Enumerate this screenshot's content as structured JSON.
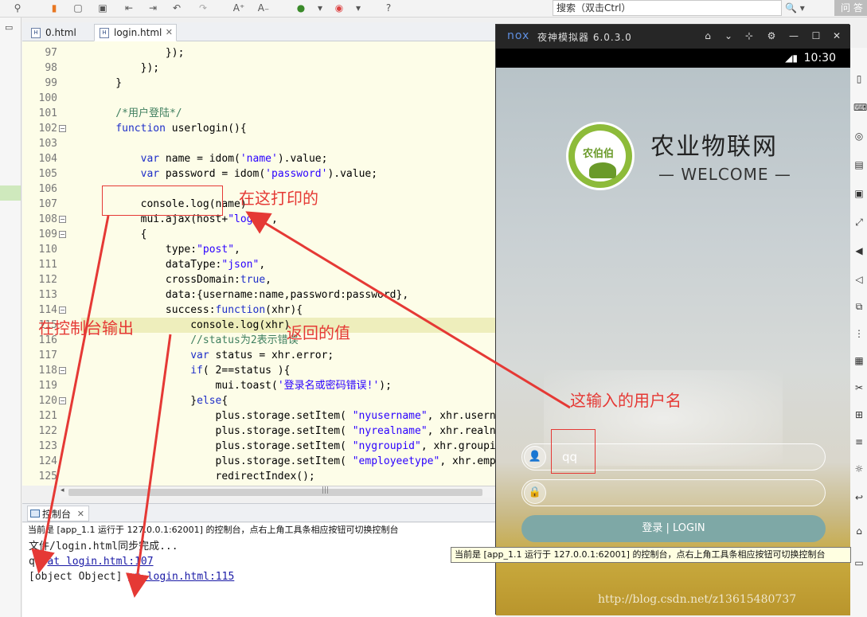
{
  "toolbar": {
    "search_placeholder": "搜索（双击Ctrl）",
    "search_button": "🔍 ▾",
    "ask_button": "问 答"
  },
  "editor": {
    "tabs": [
      {
        "label": "0.html"
      },
      {
        "label": "login.html",
        "close": "✕"
      }
    ],
    "lines": [
      {
        "num": "97",
        "text": "            });"
      },
      {
        "num": "98",
        "text": "        });"
      },
      {
        "num": "99",
        "text": "    }"
      },
      {
        "num": "100",
        "text": ""
      },
      {
        "num": "101",
        "text": "    /*用户登陆*/"
      },
      {
        "num": "102",
        "text": "    function userlogin(){"
      },
      {
        "num": "103",
        "text": ""
      },
      {
        "num": "104",
        "text": "        var name = idom('name').value;"
      },
      {
        "num": "105",
        "text": "        var password = idom('password').value;"
      },
      {
        "num": "106",
        "text": ""
      },
      {
        "num": "107",
        "text": "        console.log(name)"
      },
      {
        "num": "108",
        "text": "        mui.ajax(host+\"login\","
      },
      {
        "num": "109",
        "text": "        {"
      },
      {
        "num": "110",
        "text": "            type:\"post\","
      },
      {
        "num": "111",
        "text": "            dataType:\"json\","
      },
      {
        "num": "112",
        "text": "            crossDomain:true,"
      },
      {
        "num": "113",
        "text": "            data:{username:name,password:password},"
      },
      {
        "num": "114",
        "text": "            success:function(xhr){"
      },
      {
        "num": "115",
        "text": "                console.log(xhr)"
      },
      {
        "num": "116",
        "text": "                //status为2表示错误"
      },
      {
        "num": "117",
        "text": "                var status = xhr.error;"
      },
      {
        "num": "118",
        "text": "                if( 2==status ){"
      },
      {
        "num": "119",
        "text": "                    mui.toast('登录名或密码错误!');"
      },
      {
        "num": "120",
        "text": "                }else{"
      },
      {
        "num": "121",
        "text": "                    plus.storage.setItem( \"nyusername\", xhr.username"
      },
      {
        "num": "122",
        "text": "                    plus.storage.setItem( \"nyrealname\", xhr.realname"
      },
      {
        "num": "123",
        "text": "                    plus.storage.setItem( \"nygroupid\", xhr.groupid )"
      },
      {
        "num": "124",
        "text": "                    plus.storage.setItem( \"employeetype\", xhr.employ"
      },
      {
        "num": "125",
        "text": "                    redirectIndex();"
      }
    ],
    "fold_markers": [
      "102",
      "108",
      "109",
      "114",
      "118",
      "120"
    ]
  },
  "console": {
    "tab_label": "控制台",
    "tab_close": "✕",
    "status": "当前是 [app_1.1 运行于 127.0.0.1:62001] 的控制台，点右上角工具条相应按钮可切换控制台",
    "lines": [
      {
        "text": "文件/login.html同步完成..."
      },
      {
        "prefix": "qq ",
        "link": "at login.html:107"
      },
      {
        "prefix": "[object Object] ",
        "link": "at login.html:115"
      }
    ]
  },
  "tooltip": "当前是 [app_1.1 运行于 127.0.0.1:62001] 的控制台，点右上角工具条相应按钮可切换控制台",
  "emulator": {
    "logo": "nox",
    "title": "夜神模拟器 6.0.3.0",
    "time": "10:30",
    "app": {
      "logo_text": "农伯伯",
      "title": "农业物联网",
      "welcome": "— WELCOME —",
      "username_value": "qq",
      "password_value": "",
      "login_button": "登录 | LOGIN"
    },
    "watermark": "http://blog.csdn.net/z13615480737"
  },
  "annotations": {
    "printed_here": "在这打印的",
    "console_output": "在控制台输出",
    "returned_value": "返回的值",
    "entered_username": "这输入的用户名"
  },
  "colors": {
    "annotation": "#e53935",
    "editor_bg": "#fdfde8",
    "login_button": "#7ea8a6"
  }
}
